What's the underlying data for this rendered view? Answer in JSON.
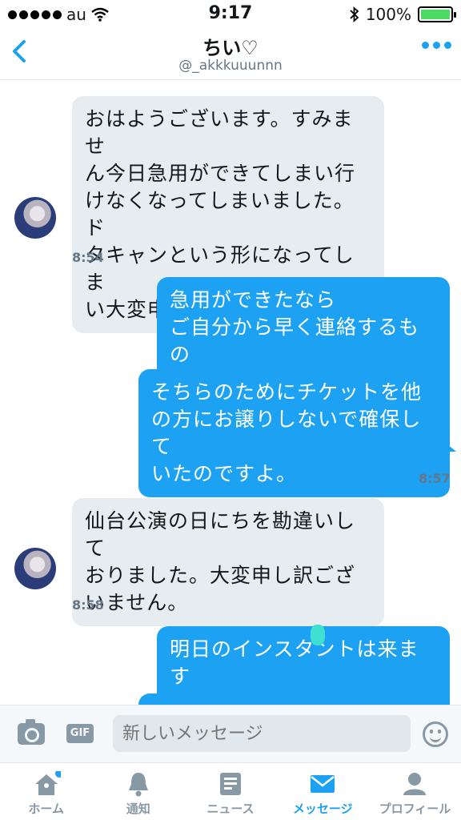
{
  "status_bar": {
    "carrier": "au",
    "time": "9:17",
    "battery": "100%",
    "battery_level": 1.0
  },
  "header": {
    "name": "ちい♡",
    "handle": "@_akkkuuunnn"
  },
  "messages": [
    {
      "text": "おはようございます。すみませ\nん今日急用ができてしまい行\nけなくなってしまいました。ド\nタキャンという形になってしま\nい大変申し訳ございません…"
    },
    {
      "text": "急用ができたなら\nご自分から早く連絡するもの\nではないですか？"
    },
    {
      "text": "そちらのためにチケットを他\nの方にお譲りしないで確保して\nいたのですよ。"
    },
    {
      "text": "仙台公演の日にちを勘違いして\nおりました。大変申し訳ござ\nいません。"
    },
    {
      "text": "明日のインスタントは来ます\nか？"
    }
  ],
  "timestamps": [
    "8:54",
    "8:57",
    "8:58"
  ],
  "composer": {
    "placeholder": "新しいメッセージ",
    "gif_label": "GIF"
  },
  "tabs": [
    {
      "label": "ホーム",
      "icon": "home-icon"
    },
    {
      "label": "通知",
      "icon": "bell-icon"
    },
    {
      "label": "ニュース",
      "icon": "news-icon"
    },
    {
      "label": "メッセージ",
      "icon": "envelope-icon",
      "active": true
    },
    {
      "label": "プロフィール",
      "icon": "person-icon"
    }
  ],
  "colors": {
    "accent": "#1da1f2",
    "incoming_bubble": "#e6ecf0",
    "muted": "#8899a6"
  }
}
